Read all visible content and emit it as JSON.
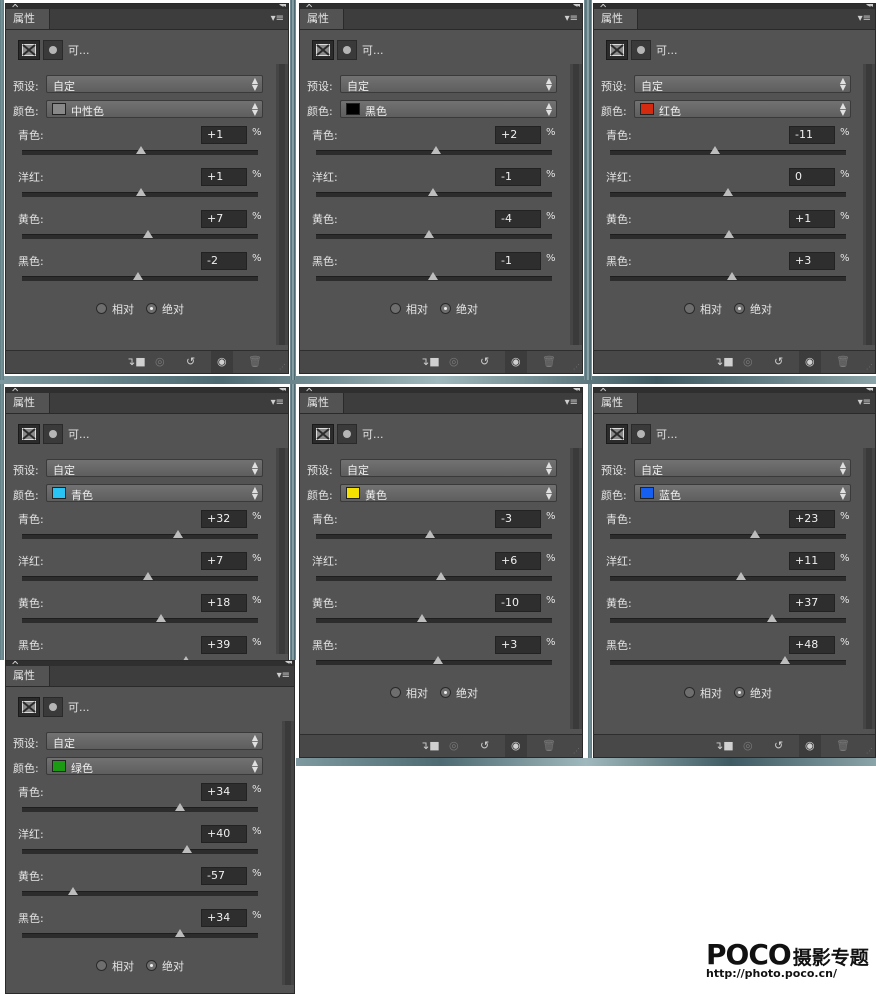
{
  "panel_common": {
    "tab_label": "属性",
    "adjust_title": "可...",
    "preset_label": "预设:",
    "preset_value": "自定",
    "color_label": "颜色:",
    "param_labels": [
      "青色:",
      "洋红:",
      "黄色:",
      "黑色:"
    ],
    "percent": "%",
    "relative_label": "相对",
    "absolute_label": "绝对",
    "close_glyph": "✕",
    "collapse_glyph": "◂◂",
    "menu_glyph": "▾≡",
    "icon_names": [
      "clip-to-layer-icon",
      "view-previous-icon",
      "reset-icon",
      "visibility-eye-icon",
      "trash-icon"
    ]
  },
  "panels": [
    {
      "color_name": "中性色",
      "swatch": "#888888",
      "values": [
        "+1",
        "+1",
        "+7",
        "-2"
      ],
      "levels": [
        1,
        1,
        7,
        -2
      ],
      "mode": "absolute"
    },
    {
      "color_name": "黑色",
      "swatch": "#000000",
      "values": [
        "+2",
        "-1",
        "-4",
        "-1"
      ],
      "levels": [
        2,
        -1,
        -4,
        -1
      ],
      "mode": "absolute"
    },
    {
      "color_name": "红色",
      "swatch": "#d42a0f",
      "values": [
        "-11",
        "0",
        "+1",
        "+3"
      ],
      "levels": [
        -11,
        0,
        1,
        3
      ],
      "mode": "absolute"
    },
    {
      "color_name": "青色",
      "swatch": "#27c4f5",
      "values": [
        "+32",
        "+7",
        "+18",
        "+39"
      ],
      "levels": [
        32,
        7,
        18,
        39
      ],
      "mode": "absolute"
    },
    {
      "color_name": "黄色",
      "swatch": "#f5e100",
      "values": [
        "-3",
        "+6",
        "-10",
        "+3"
      ],
      "levels": [
        -3,
        6,
        -10,
        3
      ],
      "mode": "absolute"
    },
    {
      "color_name": "蓝色",
      "swatch": "#1560f2",
      "values": [
        "+23",
        "+11",
        "+37",
        "+48"
      ],
      "levels": [
        23,
        11,
        37,
        48
      ],
      "mode": "absolute"
    },
    {
      "color_name": "绿色",
      "swatch": "#1a9b12",
      "values": [
        "+34",
        "+40",
        "-57",
        "+34"
      ],
      "levels": [
        34,
        40,
        -57,
        34
      ],
      "mode": "absolute"
    }
  ],
  "watermark": {
    "brand": "POCO",
    "brand_cn": "摄影专题",
    "url": "http://photo.poco.cn/"
  }
}
